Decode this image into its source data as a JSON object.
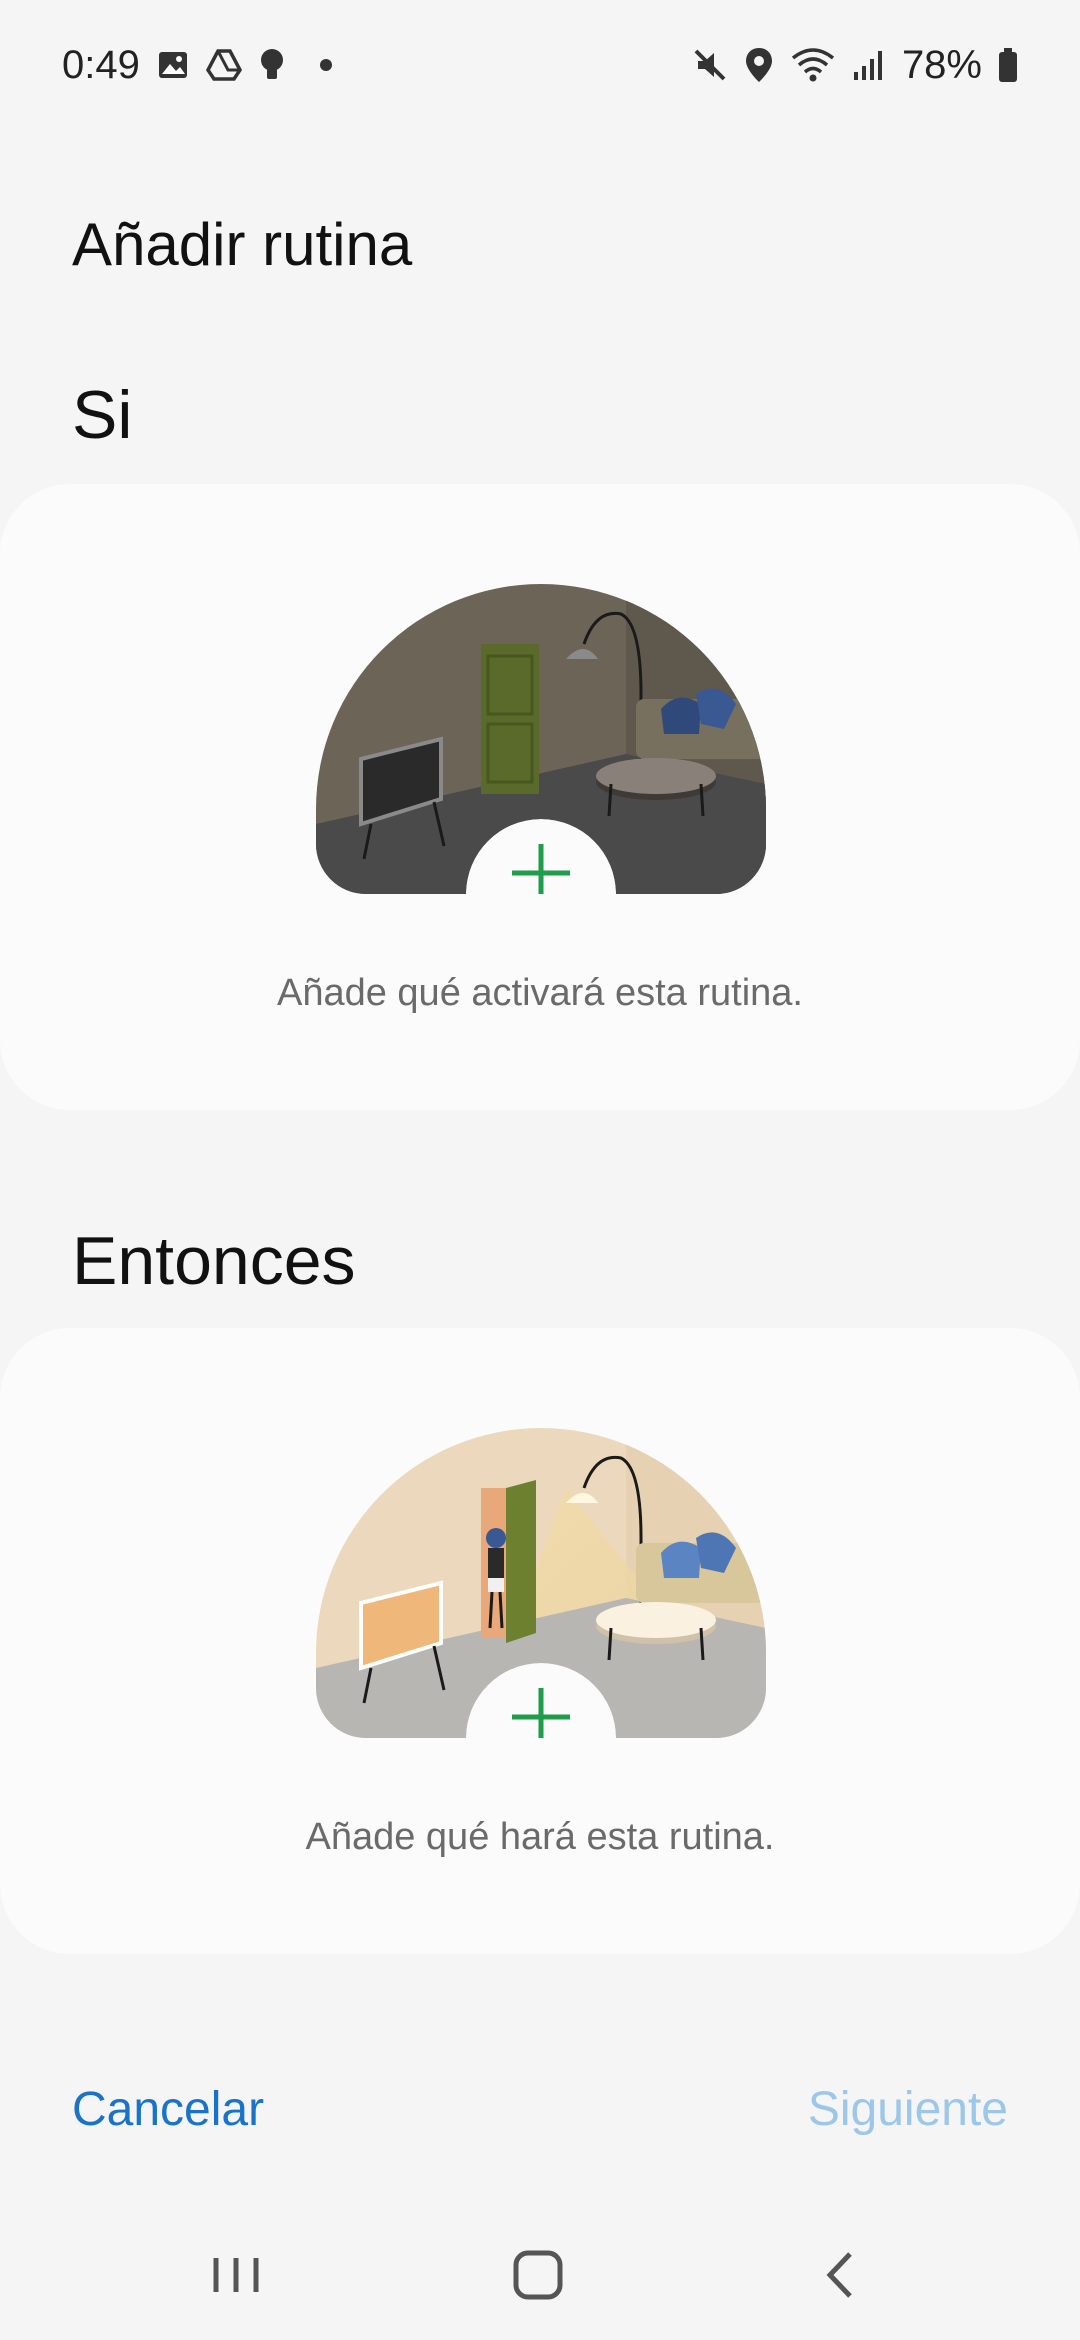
{
  "status_bar": {
    "time": "0:49",
    "battery": "78%",
    "icons": [
      "gallery-icon",
      "drive-icon",
      "bulb-icon",
      "notification-dot",
      "mute-icon",
      "location-icon",
      "wifi-icon",
      "signal-icon",
      "battery-icon"
    ]
  },
  "header": {
    "title": "Añadir rutina"
  },
  "if_section": {
    "title": "Si",
    "caption": "Añade qué activará esta rutina."
  },
  "then_section": {
    "title": "Entonces",
    "caption": "Añade qué hará esta rutina."
  },
  "actions": {
    "cancel_label": "Cancelar",
    "next_label": "Siguiente"
  },
  "colors": {
    "accent": "#1a73c9",
    "disabled_accent": "#9cc7ea",
    "plus_green": "#1f9d4a",
    "background": "#f5f5f5",
    "card": "#fbfbfb"
  },
  "nav_bar": {
    "buttons": [
      "recents-icon",
      "home-icon",
      "back-icon"
    ]
  }
}
